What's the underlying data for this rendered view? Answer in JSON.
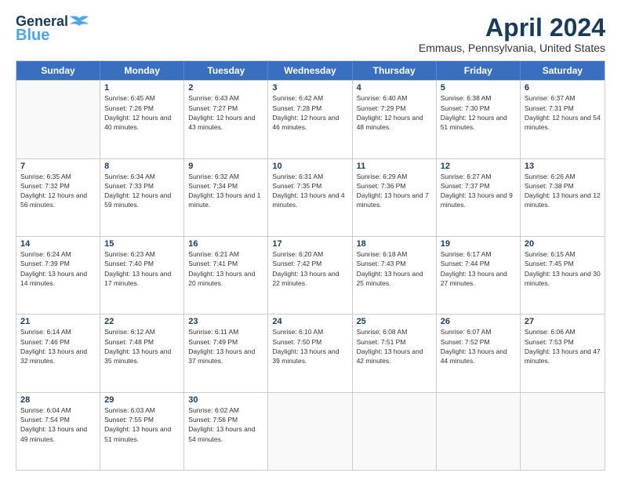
{
  "header": {
    "logo_line1": "General",
    "logo_line2": "Blue",
    "month": "April 2024",
    "location": "Emmaus, Pennsylvania, United States"
  },
  "days_of_week": [
    "Sunday",
    "Monday",
    "Tuesday",
    "Wednesday",
    "Thursday",
    "Friday",
    "Saturday"
  ],
  "weeks": [
    [
      {
        "day": "",
        "empty": true
      },
      {
        "day": "1",
        "sunrise": "Sunrise: 6:45 AM",
        "sunset": "Sunset: 7:26 PM",
        "daylight": "Daylight: 12 hours and 40 minutes."
      },
      {
        "day": "2",
        "sunrise": "Sunrise: 6:43 AM",
        "sunset": "Sunset: 7:27 PM",
        "daylight": "Daylight: 12 hours and 43 minutes."
      },
      {
        "day": "3",
        "sunrise": "Sunrise: 6:42 AM",
        "sunset": "Sunset: 7:28 PM",
        "daylight": "Daylight: 12 hours and 46 minutes."
      },
      {
        "day": "4",
        "sunrise": "Sunrise: 6:40 AM",
        "sunset": "Sunset: 7:29 PM",
        "daylight": "Daylight: 12 hours and 48 minutes."
      },
      {
        "day": "5",
        "sunrise": "Sunrise: 6:38 AM",
        "sunset": "Sunset: 7:30 PM",
        "daylight": "Daylight: 12 hours and 51 minutes."
      },
      {
        "day": "6",
        "sunrise": "Sunrise: 6:37 AM",
        "sunset": "Sunset: 7:31 PM",
        "daylight": "Daylight: 12 hours and 54 minutes."
      }
    ],
    [
      {
        "day": "7",
        "sunrise": "Sunrise: 6:35 AM",
        "sunset": "Sunset: 7:32 PM",
        "daylight": "Daylight: 12 hours and 56 minutes."
      },
      {
        "day": "8",
        "sunrise": "Sunrise: 6:34 AM",
        "sunset": "Sunset: 7:33 PM",
        "daylight": "Daylight: 12 hours and 59 minutes."
      },
      {
        "day": "9",
        "sunrise": "Sunrise: 6:32 AM",
        "sunset": "Sunset: 7:34 PM",
        "daylight": "Daylight: 13 hours and 1 minute."
      },
      {
        "day": "10",
        "sunrise": "Sunrise: 6:31 AM",
        "sunset": "Sunset: 7:35 PM",
        "daylight": "Daylight: 13 hours and 4 minutes."
      },
      {
        "day": "11",
        "sunrise": "Sunrise: 6:29 AM",
        "sunset": "Sunset: 7:36 PM",
        "daylight": "Daylight: 13 hours and 7 minutes."
      },
      {
        "day": "12",
        "sunrise": "Sunrise: 6:27 AM",
        "sunset": "Sunset: 7:37 PM",
        "daylight": "Daylight: 13 hours and 9 minutes."
      },
      {
        "day": "13",
        "sunrise": "Sunrise: 6:26 AM",
        "sunset": "Sunset: 7:38 PM",
        "daylight": "Daylight: 13 hours and 12 minutes."
      }
    ],
    [
      {
        "day": "14",
        "sunrise": "Sunrise: 6:24 AM",
        "sunset": "Sunset: 7:39 PM",
        "daylight": "Daylight: 13 hours and 14 minutes."
      },
      {
        "day": "15",
        "sunrise": "Sunrise: 6:23 AM",
        "sunset": "Sunset: 7:40 PM",
        "daylight": "Daylight: 13 hours and 17 minutes."
      },
      {
        "day": "16",
        "sunrise": "Sunrise: 6:21 AM",
        "sunset": "Sunset: 7:41 PM",
        "daylight": "Daylight: 13 hours and 20 minutes."
      },
      {
        "day": "17",
        "sunrise": "Sunrise: 6:20 AM",
        "sunset": "Sunset: 7:42 PM",
        "daylight": "Daylight: 13 hours and 22 minutes."
      },
      {
        "day": "18",
        "sunrise": "Sunrise: 6:18 AM",
        "sunset": "Sunset: 7:43 PM",
        "daylight": "Daylight: 13 hours and 25 minutes."
      },
      {
        "day": "19",
        "sunrise": "Sunrise: 6:17 AM",
        "sunset": "Sunset: 7:44 PM",
        "daylight": "Daylight: 13 hours and 27 minutes."
      },
      {
        "day": "20",
        "sunrise": "Sunrise: 6:15 AM",
        "sunset": "Sunset: 7:45 PM",
        "daylight": "Daylight: 13 hours and 30 minutes."
      }
    ],
    [
      {
        "day": "21",
        "sunrise": "Sunrise: 6:14 AM",
        "sunset": "Sunset: 7:46 PM",
        "daylight": "Daylight: 13 hours and 32 minutes."
      },
      {
        "day": "22",
        "sunrise": "Sunrise: 6:12 AM",
        "sunset": "Sunset: 7:48 PM",
        "daylight": "Daylight: 13 hours and 35 minutes."
      },
      {
        "day": "23",
        "sunrise": "Sunrise: 6:11 AM",
        "sunset": "Sunset: 7:49 PM",
        "daylight": "Daylight: 13 hours and 37 minutes."
      },
      {
        "day": "24",
        "sunrise": "Sunrise: 6:10 AM",
        "sunset": "Sunset: 7:50 PM",
        "daylight": "Daylight: 13 hours and 39 minutes."
      },
      {
        "day": "25",
        "sunrise": "Sunrise: 6:08 AM",
        "sunset": "Sunset: 7:51 PM",
        "daylight": "Daylight: 13 hours and 42 minutes."
      },
      {
        "day": "26",
        "sunrise": "Sunrise: 6:07 AM",
        "sunset": "Sunset: 7:52 PM",
        "daylight": "Daylight: 13 hours and 44 minutes."
      },
      {
        "day": "27",
        "sunrise": "Sunrise: 6:06 AM",
        "sunset": "Sunset: 7:53 PM",
        "daylight": "Daylight: 13 hours and 47 minutes."
      }
    ],
    [
      {
        "day": "28",
        "sunrise": "Sunrise: 6:04 AM",
        "sunset": "Sunset: 7:54 PM",
        "daylight": "Daylight: 13 hours and 49 minutes."
      },
      {
        "day": "29",
        "sunrise": "Sunrise: 6:03 AM",
        "sunset": "Sunset: 7:55 PM",
        "daylight": "Daylight: 13 hours and 51 minutes."
      },
      {
        "day": "30",
        "sunrise": "Sunrise: 6:02 AM",
        "sunset": "Sunset: 7:56 PM",
        "daylight": "Daylight: 13 hours and 54 minutes."
      },
      {
        "day": "",
        "empty": true
      },
      {
        "day": "",
        "empty": true
      },
      {
        "day": "",
        "empty": true
      },
      {
        "day": "",
        "empty": true
      }
    ]
  ]
}
